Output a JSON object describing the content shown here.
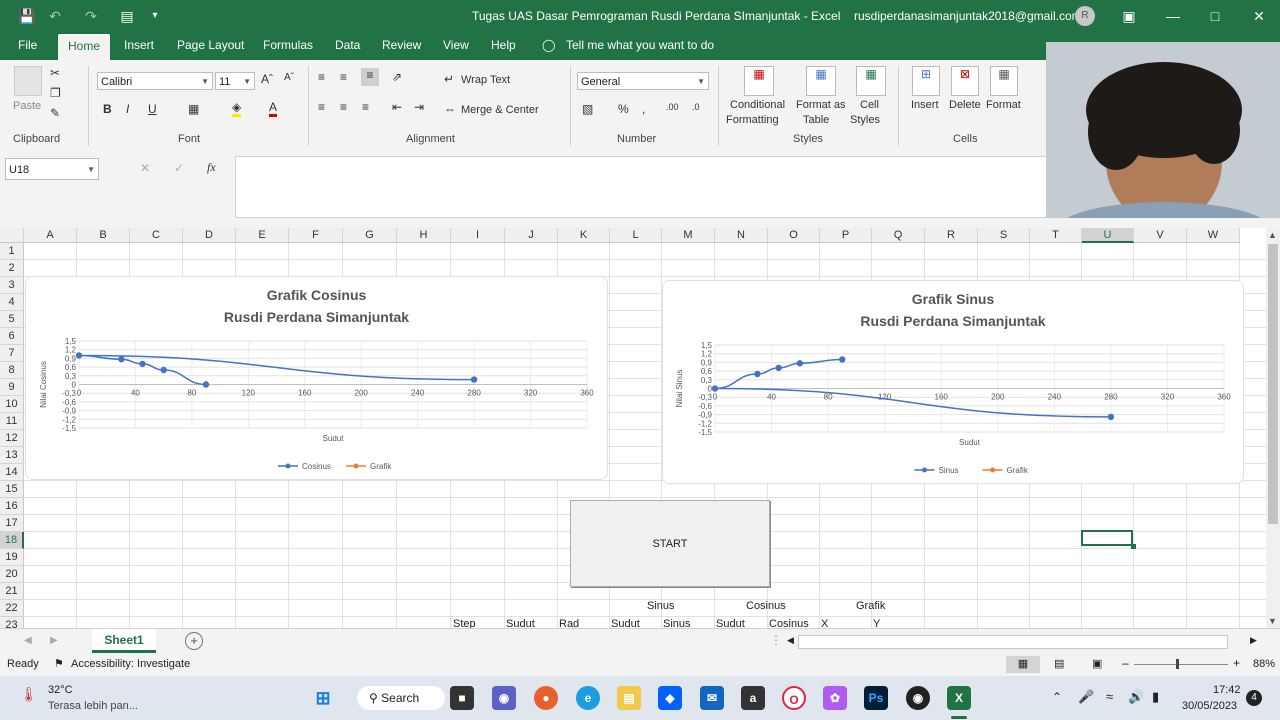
{
  "window": {
    "title": "Tugas UAS Dasar Pemrograman Rusdi Perdana SImanjuntak  -  Excel",
    "account": "rusdiperdanasimanjuntak2018@gmail.com",
    "avatar_initial": "R"
  },
  "menu": {
    "tabs": [
      "File",
      "Home",
      "Insert",
      "Page Layout",
      "Formulas",
      "Data",
      "Review",
      "View",
      "Help"
    ],
    "tell_me": "Tell me what you want to do"
  },
  "ribbon": {
    "paste": "Paste",
    "font_name": "Calibri",
    "font_size": "11",
    "bold": "B",
    "italic": "I",
    "underline": "U",
    "wrap_text": "Wrap Text",
    "merge_center": "Merge & Center",
    "number_format": "General",
    "conditional_formatting": [
      "Conditional",
      "Formatting"
    ],
    "format_as_table": [
      "Format as",
      "Table"
    ],
    "cell_styles": [
      "Cell",
      "Styles"
    ],
    "insert": "Insert",
    "delete": "Delete",
    "format": "Format",
    "groups": {
      "clipboard": "Clipboard",
      "font": "Font",
      "alignment": "Alignment",
      "number": "Number",
      "styles": "Styles",
      "cells": "Cells"
    }
  },
  "formula_bar": {
    "name_box": "U18",
    "fx": "fx",
    "value": ""
  },
  "grid": {
    "columns": [
      "A",
      "B",
      "C",
      "D",
      "E",
      "F",
      "G",
      "H",
      "I",
      "J",
      "K",
      "L",
      "M",
      "N",
      "O",
      "P",
      "Q",
      "R",
      "S",
      "T",
      "U",
      "V",
      "W"
    ],
    "rows": [
      "1",
      "2",
      "3",
      "4",
      "5",
      "6",
      "7",
      "8",
      "9",
      "10",
      "11",
      "12",
      "13",
      "14",
      "15",
      "16",
      "17",
      "18",
      "19",
      "20",
      "21",
      "22",
      "23"
    ],
    "selected_cell": "U18",
    "cells_row22": {
      "M": "Sinus",
      "O": "Cosinus",
      "Q": "Grafik"
    },
    "cells_row23": {
      "I": "Step",
      "J": "Sudut",
      "K": "Rad",
      "L": "Sudut",
      "M": "Sinus",
      "N": "Sudut",
      "O": "Cosinus",
      "P": "X",
      "Q": "Y"
    }
  },
  "start_button": "START",
  "chart_data": [
    {
      "type": "line",
      "title": "Grafik Cosinus",
      "subtitle": "Rusdi Perdana Simanjuntak",
      "xlabel": "Sudut",
      "ylabel": "Nilai Cosinus",
      "xlim": [
        0,
        360
      ],
      "ylim": [
        -1.5,
        1.5
      ],
      "x_ticks": [
        "0",
        "40",
        "80",
        "120",
        "160",
        "200",
        "240",
        "280",
        "320",
        "360"
      ],
      "y_ticks": [
        "1,5",
        "1,2",
        "0,9",
        "0,6",
        "0,3",
        "0",
        "-0,3",
        "-0,6",
        "-0,9",
        "-1,2",
        "-1,5"
      ],
      "legend": [
        "Cosinus",
        "Grafik"
      ],
      "legend_position": "bottom",
      "series": [
        {
          "name": "Cosinus",
          "color": "#4472c4",
          "x": [
            280,
            0,
            30,
            45,
            60,
            90
          ],
          "y": [
            0.17,
            1.0,
            0.87,
            0.71,
            0.5,
            0
          ]
        }
      ]
    },
    {
      "type": "line",
      "title": "Grafik Sinus",
      "subtitle": "Rusdi Perdana Simanjuntak",
      "xlabel": "Sudut",
      "ylabel": "Nilai Sinus",
      "xlim": [
        0,
        360
      ],
      "ylim": [
        -1.5,
        1.5
      ],
      "x_ticks": [
        "0",
        "40",
        "80",
        "120",
        "160",
        "200",
        "240",
        "280",
        "320",
        "360"
      ],
      "y_ticks": [
        "1,5",
        "1,2",
        "0,9",
        "0,6",
        "0,3",
        "0",
        "-0,3",
        "-0,6",
        "-0,9",
        "-1,2",
        "-1,5"
      ],
      "legend": [
        "Sinus",
        "Grafik"
      ],
      "legend_position": "bottom",
      "series": [
        {
          "name": "Sinus",
          "color": "#4472c4",
          "x": [
            280,
            0,
            30,
            45,
            60,
            90
          ],
          "y": [
            -0.98,
            0,
            0.5,
            0.71,
            0.87,
            1.0
          ]
        }
      ]
    }
  ],
  "sheets": {
    "active": "Sheet1"
  },
  "status": {
    "ready": "Ready",
    "accessibility": "Accessibility: Investigate",
    "zoom": "88%"
  },
  "taskbar": {
    "weather_temp": "32°C",
    "weather_desc": "Terasa lebih pan...",
    "search": "Search",
    "time": "17:42",
    "date": "30/05/2023",
    "notifications": "4"
  },
  "colors": {
    "excel_green": "#217346",
    "series": "#4472c4",
    "grafik_series": "#ed7d31"
  }
}
